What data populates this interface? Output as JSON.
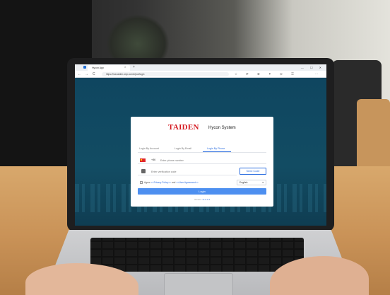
{
  "browser": {
    "tab_title": "Hycon App",
    "tab_close": "×",
    "new_tab": "+",
    "window_controls": "— ☐ ✕",
    "url": "https://hcs.taiden.cmp.com/#/pub/login",
    "nav": {
      "back": "←",
      "forward": "→",
      "refresh": "C"
    },
    "toolbar_icons": [
      "☆",
      "⟳",
      "⊕",
      "✦",
      "⊙",
      "☰",
      "⋯"
    ]
  },
  "login": {
    "brand": "TAIDEN",
    "product": "Hycon System",
    "tabs": [
      {
        "label": "Login By Account"
      },
      {
        "label": "Login By Email"
      },
      {
        "label": "Login By Phone"
      }
    ],
    "dial_code": "+86",
    "phone_placeholder": "Enter phone number",
    "code_placeholder": "Enter verification code",
    "send_code": "Send Code",
    "agree_prefix": "Agree",
    "privacy_link": "<<Privacy Policy>>",
    "agree_and": "and",
    "user_agreement_link": "<<User Agreement>>",
    "language": "English",
    "login_button": "Login",
    "version_label": "Version:",
    "version_value": "v1.0.0.1"
  },
  "colors": {
    "brand_red": "#d4161d",
    "accent_blue": "#2e6fe0",
    "login_button": "#4d8ff0",
    "page_background": "#0f4660"
  }
}
